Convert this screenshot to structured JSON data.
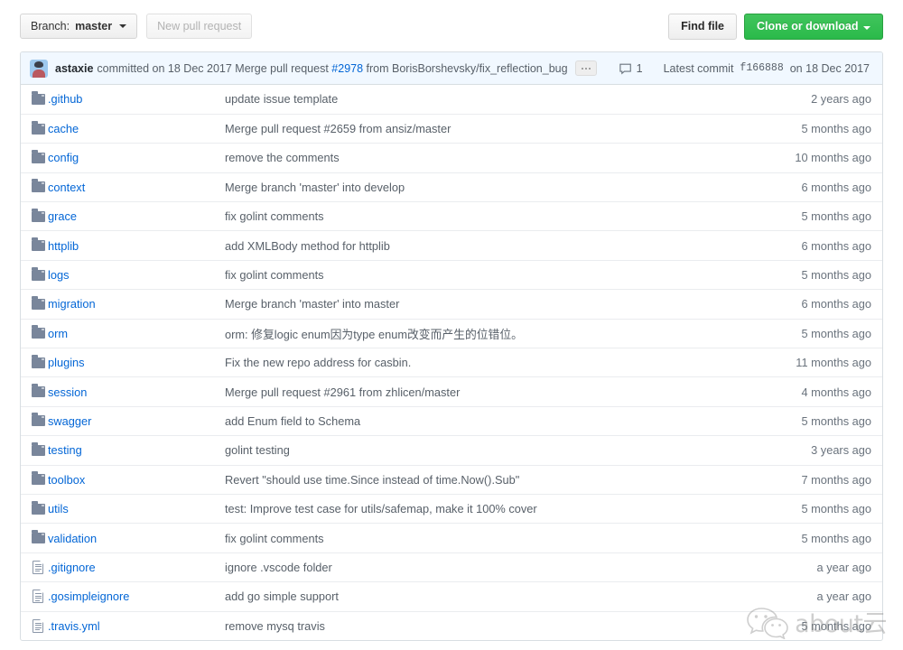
{
  "toolbar": {
    "branch_label_prefix": "Branch:",
    "branch_name": "master",
    "new_pull_request_label": "New pull request",
    "find_file_label": "Find file",
    "clone_label": "Clone or download"
  },
  "commit_bar": {
    "author": "astaxie",
    "committed_text": "committed on 18 Dec 2017",
    "message_prefix": "Merge pull request",
    "pr_number": "#2978",
    "message_suffix": "from BorisBorshevsky/fix_reflection_bug",
    "expand_label": "...",
    "comment_count": "1",
    "latest_commit_label": "Latest commit",
    "commit_hash": "f166888",
    "commit_date": "on 18 Dec 2017"
  },
  "files": [
    {
      "type": "folder",
      "name": ".github",
      "message": "update issue template",
      "age": "2 years ago"
    },
    {
      "type": "folder",
      "name": "cache",
      "message": "Merge pull request #2659 from ansiz/master",
      "age": "5 months ago"
    },
    {
      "type": "folder",
      "name": "config",
      "message": "remove the comments",
      "age": "10 months ago"
    },
    {
      "type": "folder",
      "name": "context",
      "message": "Merge branch 'master' into develop",
      "age": "6 months ago"
    },
    {
      "type": "folder",
      "name": "grace",
      "message": "fix golint comments",
      "age": "5 months ago"
    },
    {
      "type": "folder",
      "name": "httplib",
      "message": "add XMLBody method for httplib",
      "age": "6 months ago"
    },
    {
      "type": "folder",
      "name": "logs",
      "message": "fix golint comments",
      "age": "5 months ago"
    },
    {
      "type": "folder",
      "name": "migration",
      "message": "Merge branch 'master' into master",
      "age": "6 months ago"
    },
    {
      "type": "folder",
      "name": "orm",
      "message": "orm: 修复logic enum因为type enum改变而产生的位错位。",
      "age": "5 months ago"
    },
    {
      "type": "folder",
      "name": "plugins",
      "message": "Fix the new repo address for casbin.",
      "age": "11 months ago"
    },
    {
      "type": "folder",
      "name": "session",
      "message": "Merge pull request #2961 from zhlicen/master",
      "age": "4 months ago"
    },
    {
      "type": "folder",
      "name": "swagger",
      "message": "add Enum field to Schema",
      "age": "5 months ago"
    },
    {
      "type": "folder",
      "name": "testing",
      "message": "golint testing",
      "age": "3 years ago"
    },
    {
      "type": "folder",
      "name": "toolbox",
      "message": "Revert \"should use time.Since instead of time.Now().Sub\"",
      "age": "7 months ago"
    },
    {
      "type": "folder",
      "name": "utils",
      "message": "test: Improve test case for utils/safemap, make it 100% cover",
      "age": "5 months ago"
    },
    {
      "type": "folder",
      "name": "validation",
      "message": "fix golint comments",
      "age": "5 months ago"
    },
    {
      "type": "file",
      "name": ".gitignore",
      "message": "ignore .vscode folder",
      "age": "a year ago"
    },
    {
      "type": "file",
      "name": ".gosimpleignore",
      "message": "add go simple support",
      "age": "a year ago"
    },
    {
      "type": "file",
      "name": ".travis.yml",
      "message": "remove mysq travis",
      "age": "5 months ago"
    }
  ],
  "watermark": {
    "text": "about云"
  },
  "colors": {
    "link": "#0366d6",
    "muted": "#586069",
    "clone_green": "#2cbe4e",
    "commit_bar_bg": "#f1f8ff",
    "border": "#d8dee2"
  }
}
